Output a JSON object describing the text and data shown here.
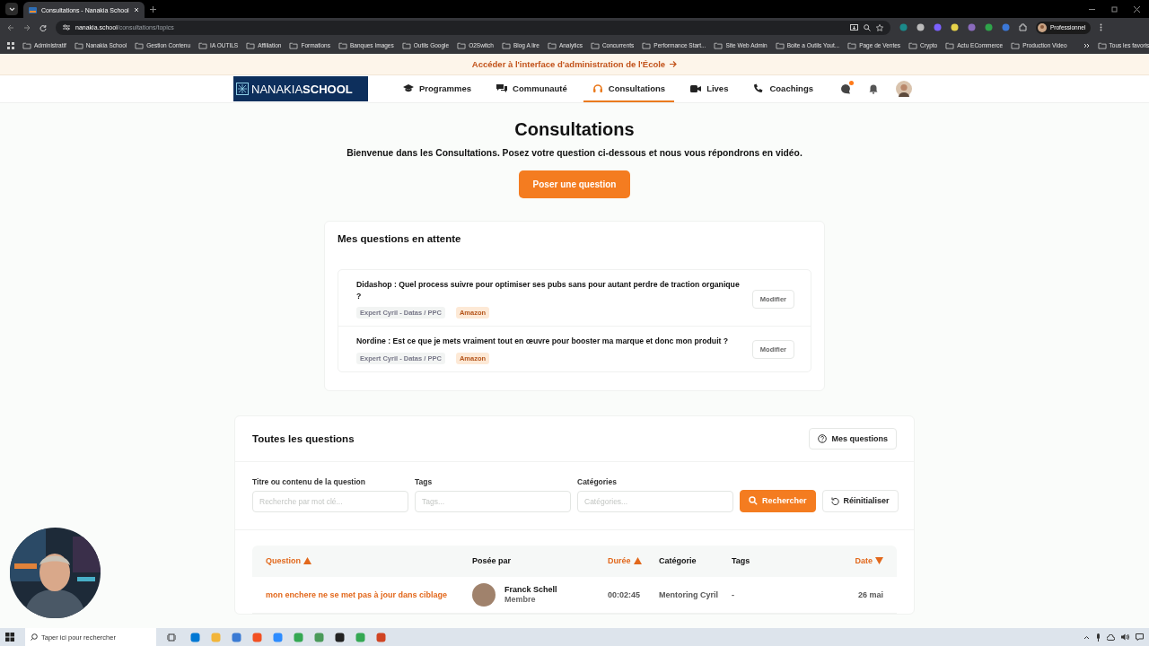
{
  "browser": {
    "tab_title": "Consultations - Nanakia School",
    "address": {
      "host": "nanakia.school",
      "path": "/consultations/topics"
    },
    "profile": "Professionnel",
    "bookmarks": [
      "Administratif",
      "Nanakia School",
      "Gestion Contenu",
      "IA OUTILS",
      "Affiliation",
      "Formations",
      "Banques Images",
      "Outils Google",
      "O2Switch",
      "Blog A lire",
      "Analytics",
      "Concurrents",
      "Performance Start...",
      "Site Web Admin",
      "Boite a Outils Yout...",
      "Page de Ventes",
      "Crypto",
      "Actu ECommerce",
      "Production Video"
    ],
    "all_bookmarks": "Tous les favoris"
  },
  "banner": "Accéder à l'interface d'administration de l'École",
  "logo": {
    "first": "NANAKIA",
    "second": "SCHOOL"
  },
  "nav": [
    {
      "label": "Programmes",
      "kind": "cap",
      "selected": false
    },
    {
      "label": "Communauté",
      "kind": "chat",
      "selected": false
    },
    {
      "label": "Consultations",
      "kind": "headset",
      "selected": true
    },
    {
      "label": "Lives",
      "kind": "video",
      "selected": false
    },
    {
      "label": "Coachings",
      "kind": "phone",
      "selected": false
    }
  ],
  "messages": {
    "unread": true
  },
  "hero": {
    "title": "Consultations",
    "subtitle": "Bienvenue dans les Consultations. Posez votre question ci-dessous et nous vous répondrons en vidéo.",
    "button": "Poser une question"
  },
  "pending": {
    "title": "Mes questions en attente",
    "items": [
      {
        "title": "Didashop : Quel process suivre pour optimiser ses pubs sans pour autant perdre de traction organique ?",
        "expert": "Expert Cyril - Datas / PPC",
        "tag": "Amazon",
        "action": "Modifier"
      },
      {
        "title": "Nordine : Est ce que je mets vraiment tout en œuvre pour booster ma marque et donc mon produit ?",
        "expert": "Expert Cyril - Datas / PPC",
        "tag": "Amazon",
        "action": "Modifier"
      }
    ]
  },
  "questions": {
    "title": "Toutes les questions",
    "my_button": "Mes questions",
    "filters": [
      {
        "label": "Titre ou contenu de la question",
        "placeholder": "Recherche par mot clé..."
      },
      {
        "label": "Tags",
        "placeholder": "Tags..."
      },
      {
        "label": "Catégories",
        "placeholder": "Catégories..."
      }
    ],
    "search_button": "Rechercher",
    "reset_button": "Réinitialiser",
    "columns": [
      {
        "label": "Question",
        "sorted": true,
        "ascending": true
      },
      {
        "label": "Posée par",
        "sorted": false
      },
      {
        "label": "Durée",
        "sorted": true,
        "ascending": true
      },
      {
        "label": "Catégorie",
        "sorted": false
      },
      {
        "label": "Tags",
        "sorted": false
      },
      {
        "label": "Date",
        "sorted": true,
        "ascending": false
      }
    ],
    "rows": [
      {
        "question": "mon enchere ne se met pas à jour dans ciblage",
        "author": "Franck Schell",
        "role": "Membre",
        "duration": "00:02:45",
        "category": "Mentoring Cyril",
        "tags": "-",
        "date": "26 mai"
      }
    ]
  },
  "taskbar": {
    "search_placeholder": "Taper ici pour rechercher"
  }
}
